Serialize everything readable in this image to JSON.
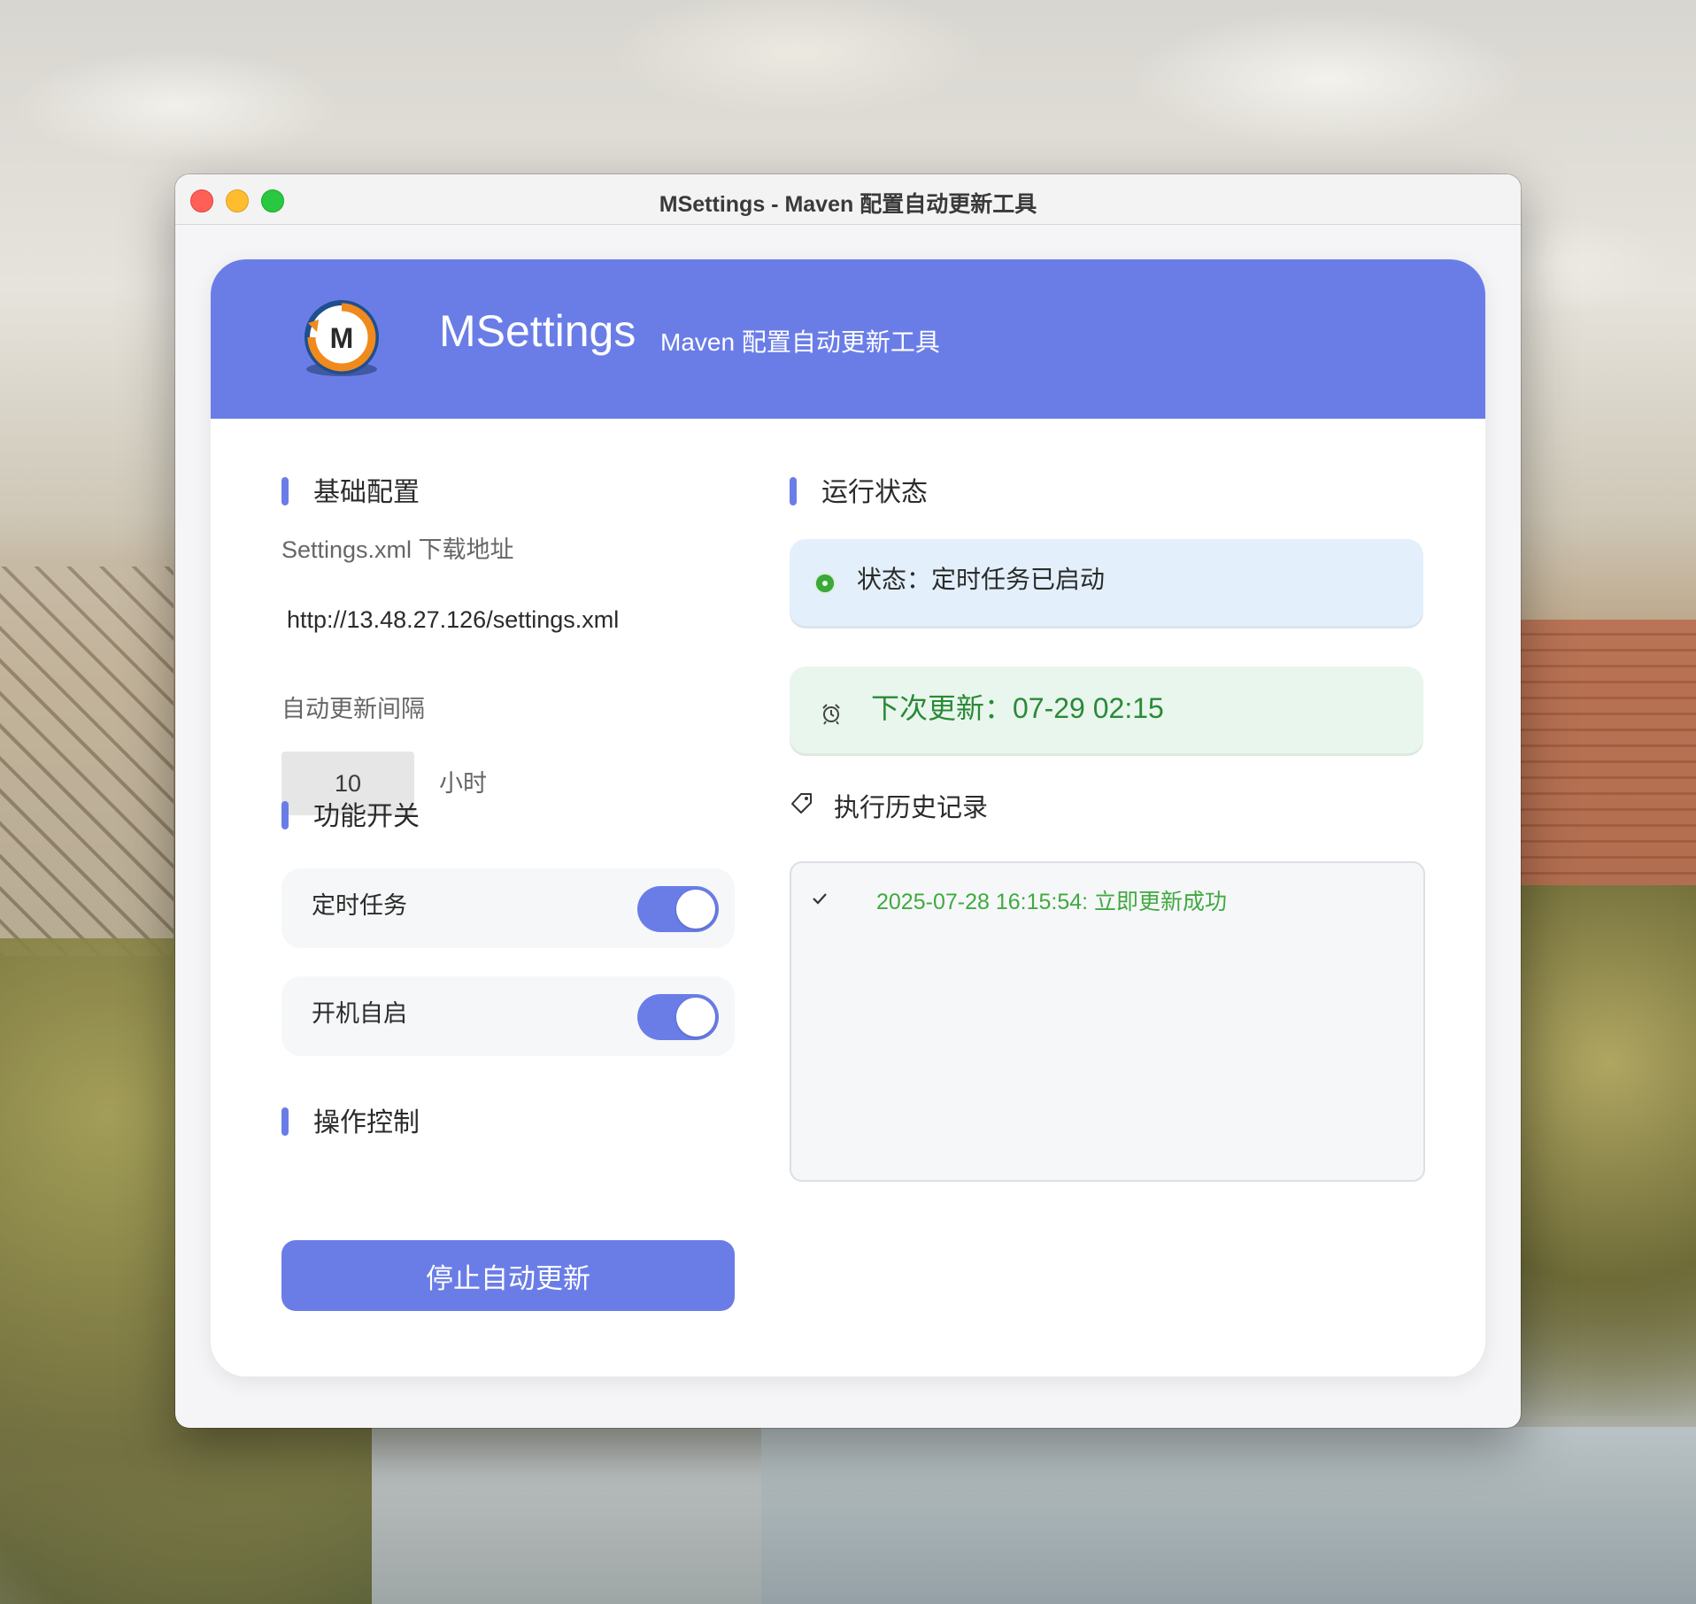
{
  "window": {
    "title": "MSettings - Maven 配置自动更新工具"
  },
  "header": {
    "app_name": "MSettings",
    "subtitle": "Maven 配置自动更新工具"
  },
  "basic_config": {
    "title": "基础配置",
    "url_label": "Settings.xml 下载地址",
    "url_value": "http://13.48.27.126/settings.xml",
    "interval_label": "自动更新间隔",
    "interval_value": "10",
    "interval_unit": "小时"
  },
  "features": {
    "title": "功能开关",
    "items": [
      {
        "label": "定时任务",
        "enabled": true
      },
      {
        "label": "开机自启",
        "enabled": true
      }
    ]
  },
  "controls": {
    "title": "操作控制",
    "stop_button": "停止自动更新"
  },
  "runtime": {
    "title": "运行状态",
    "status_text": "状态：定时任务已启动",
    "next_update_text": "下次更新：07-29 02:15",
    "history_title": "执行历史记录",
    "history": [
      {
        "text": "2025-07-28 16:15:54: 立即更新成功",
        "icon": "check-icon"
      }
    ]
  },
  "colors": {
    "accent": "#6a7de7",
    "success": "#3faa3f",
    "status_bg": "#e3f0fb",
    "next_bg": "#e9f6ee"
  }
}
